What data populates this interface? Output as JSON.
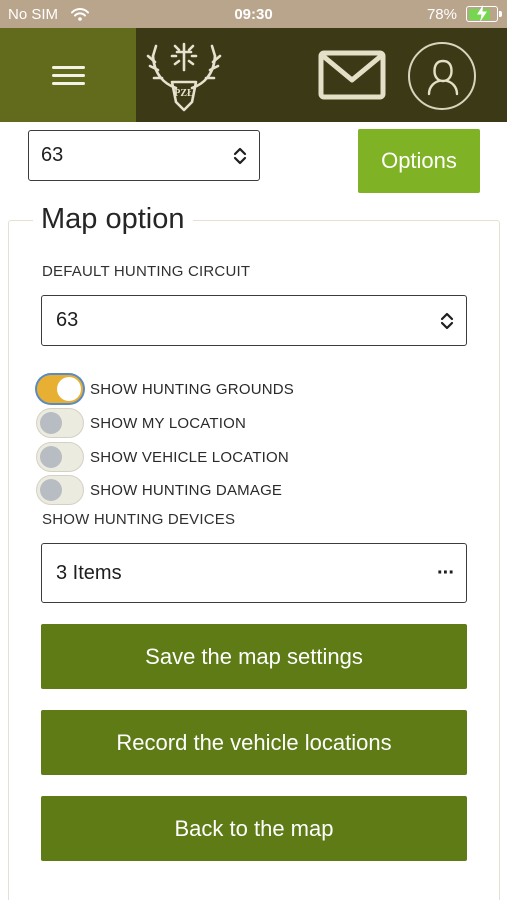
{
  "status_bar": {
    "carrier": "No SIM",
    "time": "09:30",
    "battery": "78%",
    "battery_level": 0.78
  },
  "header": {
    "menu_icon": "hamburger-icon",
    "logo_text": "PZŁ",
    "mail_icon": "envelope-icon",
    "profile_icon": "user-icon"
  },
  "top": {
    "circuit_value": "63",
    "options_label": "Options"
  },
  "map_option": {
    "title": "Map option",
    "default_circuit_label": "DEFAULT HUNTING CIRCUIT",
    "default_circuit_value": "63",
    "toggles": [
      {
        "label": "SHOW HUNTING GROUNDS",
        "on": true
      },
      {
        "label": "SHOW MY LOCATION",
        "on": false
      },
      {
        "label": "SHOW VEHICLE LOCATION",
        "on": false
      },
      {
        "label": "SHOW HUNTING DAMAGE",
        "on": false
      }
    ],
    "devices_label": "SHOW HUNTING DEVICES",
    "devices_value": "3 Items",
    "devices_more": "···"
  },
  "actions": {
    "save": "Save the map settings",
    "record": "Record the vehicle locations",
    "back": "Back to the map"
  },
  "colors": {
    "header_dark": "#3c3916",
    "menu_olive": "#626b1b",
    "options_green": "#7fb224",
    "action_green": "#5e7b16",
    "toggle_on": "#e7b032",
    "status_bar": "#b9a48c"
  }
}
